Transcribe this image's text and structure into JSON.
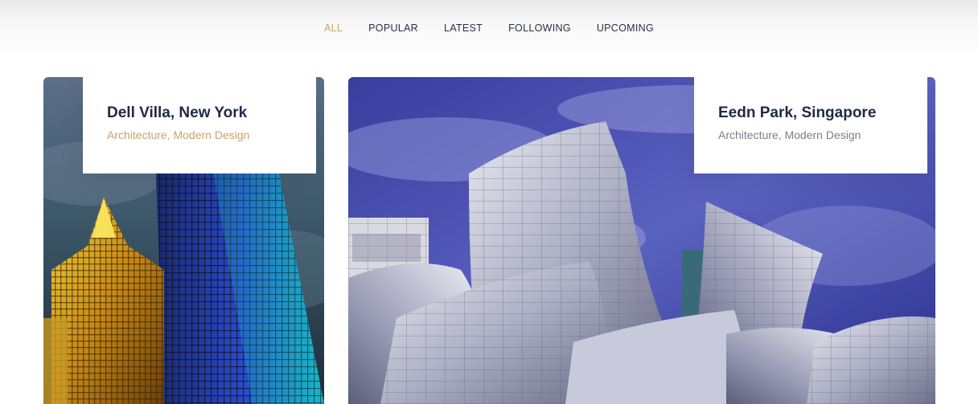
{
  "filters": {
    "items": [
      {
        "label": "ALL",
        "active": true
      },
      {
        "label": "POPULAR",
        "active": false
      },
      {
        "label": "LATEST",
        "active": false
      },
      {
        "label": "FOLLOWING",
        "active": false
      },
      {
        "label": "UPCOMING",
        "active": false
      }
    ],
    "active_color": "#c9a26b",
    "text_color": "#2b2f44"
  },
  "cards": [
    {
      "title": "Dell Villa, New York",
      "subtitle": "Architecture, Modern Design",
      "subtitle_color": "#c9a26b",
      "image": "skyscrapers-photo"
    },
    {
      "title": "Eedn Park, Singapore",
      "subtitle": "Architecture, Modern Design",
      "subtitle_color": "#7b7f86",
      "image": "curved-steel-building-photo"
    }
  ]
}
